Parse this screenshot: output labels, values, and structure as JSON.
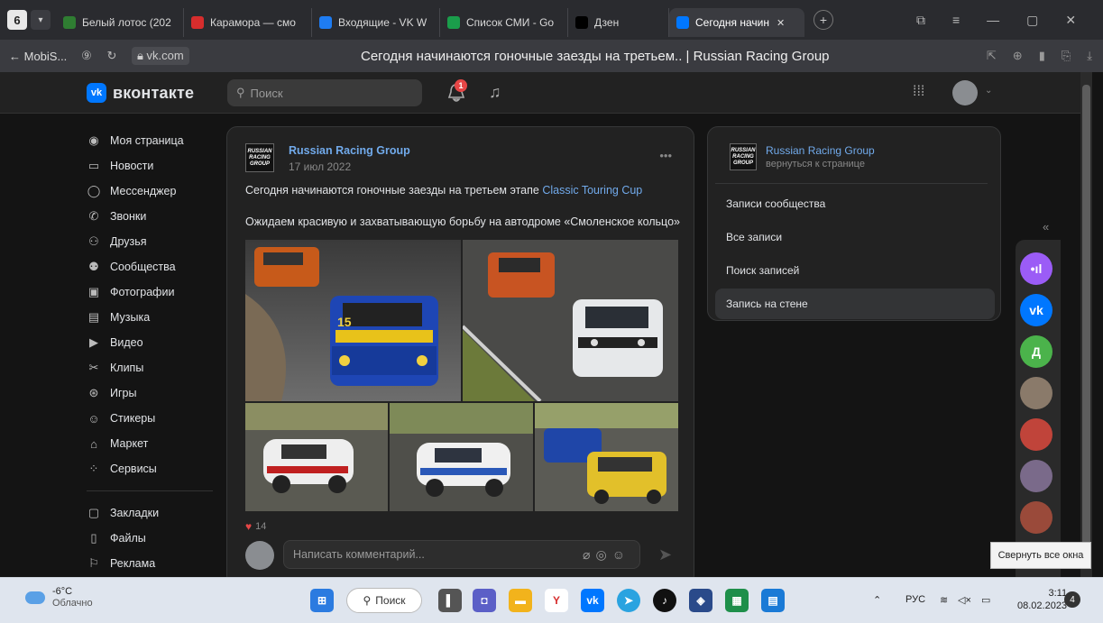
{
  "browser": {
    "tab_count": "6",
    "tabs": [
      {
        "label": "Белый лотос (202",
        "icon": "tab-favicon-lotus",
        "color": "#2f7d32"
      },
      {
        "label": "Карамора — смо",
        "icon": "tab-favicon-kinopoisk",
        "color": "#d62d2d"
      },
      {
        "label": "Входящие - VK W",
        "icon": "tab-favicon-mail",
        "color": "#1e7cf2"
      },
      {
        "label": "Список СМИ - Go",
        "icon": "tab-favicon-sheets",
        "color": "#1a9d4b"
      },
      {
        "label": "Дзен",
        "icon": "tab-favicon-dzen",
        "color": "#000000"
      },
      {
        "label": "Сегодня начин",
        "icon": "tab-favicon-vk",
        "color": "#0077ff",
        "active": true
      }
    ],
    "back_label": "← MobiS...",
    "url": "vk.com",
    "page_title": "Сегодня начинаются гоночные заезды на третьем.. | Russian Racing Group"
  },
  "header": {
    "logo_text": "вконтакте",
    "search_placeholder": "Поиск",
    "notification_count": "1"
  },
  "sidebar": {
    "items": [
      {
        "label": "Моя страница",
        "icon": "user-icon",
        "glyph": "◉"
      },
      {
        "label": "Новости",
        "icon": "news-icon",
        "glyph": "▭"
      },
      {
        "label": "Мессенджер",
        "icon": "messenger-icon",
        "glyph": "◯"
      },
      {
        "label": "Звонки",
        "icon": "phone-icon",
        "glyph": "✆"
      },
      {
        "label": "Друзья",
        "icon": "friends-icon",
        "glyph": "⚇"
      },
      {
        "label": "Сообщества",
        "icon": "communities-icon",
        "glyph": "⚉"
      },
      {
        "label": "Фотографии",
        "icon": "photo-icon",
        "glyph": "▣"
      },
      {
        "label": "Музыка",
        "icon": "music-icon",
        "glyph": "▤"
      },
      {
        "label": "Видео",
        "icon": "video-icon",
        "glyph": "▶"
      },
      {
        "label": "Клипы",
        "icon": "clips-icon",
        "glyph": "✂"
      },
      {
        "label": "Игры",
        "icon": "games-icon",
        "glyph": "⊛"
      },
      {
        "label": "Стикеры",
        "icon": "stickers-icon",
        "glyph": "☺"
      },
      {
        "label": "Маркет",
        "icon": "market-icon",
        "glyph": "⌂"
      },
      {
        "label": "Сервисы",
        "icon": "services-icon",
        "glyph": "⁘"
      }
    ],
    "items2": [
      {
        "label": "Закладки",
        "icon": "bookmarks-icon",
        "glyph": "▢"
      },
      {
        "label": "Файлы",
        "icon": "files-icon",
        "glyph": "▯"
      },
      {
        "label": "Реклама",
        "icon": "ads-icon",
        "glyph": "⚐"
      }
    ]
  },
  "post": {
    "group_logo_text": "RUSSIAN RACING GROUP",
    "group_name": "Russian Racing Group",
    "date": "17 июл 2022",
    "text_before_link": "Сегодня начинаются гоночные заезды на третьем этапе ",
    "link_text": "Classic Touring Cup",
    "text2": "Ожидаем красивую и захватывающую борьбу на автодроме «Смоленское кольцо»",
    "likes": "14",
    "comment_placeholder": "Написать комментарий..."
  },
  "right_panel": {
    "group_name": "Russian Racing Group",
    "back_text": "вернуться к странице",
    "links": [
      "Записи сообщества",
      "Все записи",
      "Поиск записей",
      "Запись на стене"
    ],
    "selected_index": 3
  },
  "chats": [
    {
      "name": "chat-podcast",
      "color": "#9b5cf6",
      "text": "•ıl"
    },
    {
      "name": "chat-vk",
      "color": "#0077ff",
      "text": "vk"
    },
    {
      "name": "chat-d",
      "color": "#4bb34b",
      "text": "Д"
    },
    {
      "name": "chat-avatar-1",
      "color": "#8a7a6a",
      "text": ""
    },
    {
      "name": "chat-avatar-2",
      "color": "#c0443a",
      "text": ""
    },
    {
      "name": "chat-avatar-3",
      "color": "#7a6a8a",
      "text": ""
    },
    {
      "name": "chat-avatar-4",
      "color": "#9a4a3a",
      "text": ""
    }
  ],
  "tooltip": "Свернуть все окна",
  "taskbar": {
    "temperature": "-6°C",
    "weather": "Облачно",
    "search_label": "Поиск",
    "lang": "РУС",
    "time": "3:11",
    "date": "08.02.2023",
    "notifications": "4"
  }
}
